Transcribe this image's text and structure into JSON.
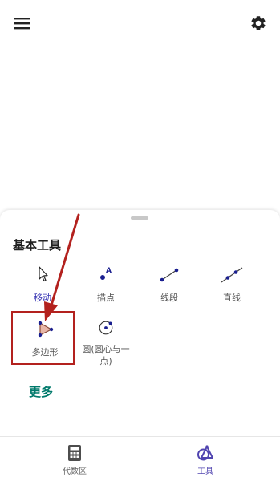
{
  "header": {
    "menu_icon": "hamburger-menu-icon",
    "settings_icon": "gear-icon"
  },
  "sheet": {
    "section_title": "基本工具",
    "tools": [
      {
        "id": "move",
        "label": "移动",
        "icon": "arrow-cursor-icon",
        "active": true
      },
      {
        "id": "point",
        "label": "描点",
        "icon": "point-a-icon",
        "active": false
      },
      {
        "id": "segment",
        "label": "线段",
        "icon": "segment-icon",
        "active": false
      },
      {
        "id": "line",
        "label": "直线",
        "icon": "line-icon",
        "active": false
      },
      {
        "id": "polygon",
        "label": "多边形",
        "icon": "polygon-icon",
        "active": false
      },
      {
        "id": "circle",
        "label": "圆(圆心与一点)",
        "label_line1": "圆(圆心与一",
        "label_line2": "点)",
        "icon": "circle-center-point-icon",
        "active": false
      }
    ],
    "more_label": "更多"
  },
  "annotation": {
    "color": "#b3211e"
  },
  "bottom_nav": {
    "items": [
      {
        "label": "代数区",
        "icon": "calculator-icon",
        "active": false
      },
      {
        "label": "工具",
        "icon": "tools-shapes-icon",
        "active": true
      }
    ]
  },
  "colors": {
    "accent": "#3a37b4",
    "point_blue": "#1a1f8f",
    "more_teal": "#00796b",
    "polygon_fill": "#e8b7a8"
  }
}
